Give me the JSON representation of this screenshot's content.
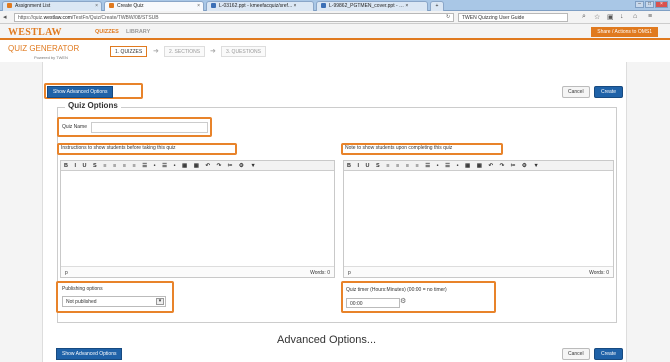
{
  "browser": {
    "tabs": [
      {
        "label": "Assignment List",
        "color": "#e07a1f"
      },
      {
        "label": "Create Quiz",
        "color": "#e07a1f"
      },
      {
        "label": "L-03162.ppt - kmeefacquiz/sref... ×",
        "color": "#3b6fb6"
      },
      {
        "label": "L-99862_PGTMEN_cover.ppt - … ×",
        "color": "#3b6fb6"
      }
    ],
    "new_tab": "+",
    "url_prefix": "https://quiz.",
    "url_domain": "westlaw.com",
    "url_path": "/TestFn/Quiz/Create/TWBW/08/STSUB",
    "search_text": "TWEN Quizzing User Guide"
  },
  "westlaw": {
    "logo": "WESTLAW",
    "nav_quizzes": "QUIZZES",
    "nav_library": "LIBRARY",
    "right_button": "Share / Actions to OMS1"
  },
  "quiz_generator": {
    "title": "QUIZ GENERATOR",
    "powered": "Powered by TWEN",
    "steps": [
      "1. QUIZZES",
      "2. SECTIONS",
      "3. QUESTIONS"
    ]
  },
  "buttons": {
    "show_advanced": "Show Advanced Options",
    "cancel": "Cancel",
    "create": "Create"
  },
  "form": {
    "legend": "Quiz Options",
    "quiz_name_label": "Quiz Name",
    "instructions_label": "Instructions to show students before taking this quiz",
    "note_label": "Note to show students upon completing this quiz",
    "toolbar": "B I U S ≡ ≡ ≡ ≡ ☰ • ☰ • ▦ ▦ ↶ ↷ ✂ ⚙ ▼",
    "path_tag": "p",
    "words_label": "Words: 0",
    "publishing_label": "Publishing options",
    "publishing_value": "Not published",
    "timer_label": "Quiz timer (Hours:Minutes) (00:00 = no timer)",
    "timer_value": "00:00"
  },
  "advanced": {
    "title": "Advanced Options..."
  },
  "colors": {
    "accent": "#e07a1f",
    "button_blue": "#1f62a8",
    "highlight": "#e8832a"
  }
}
